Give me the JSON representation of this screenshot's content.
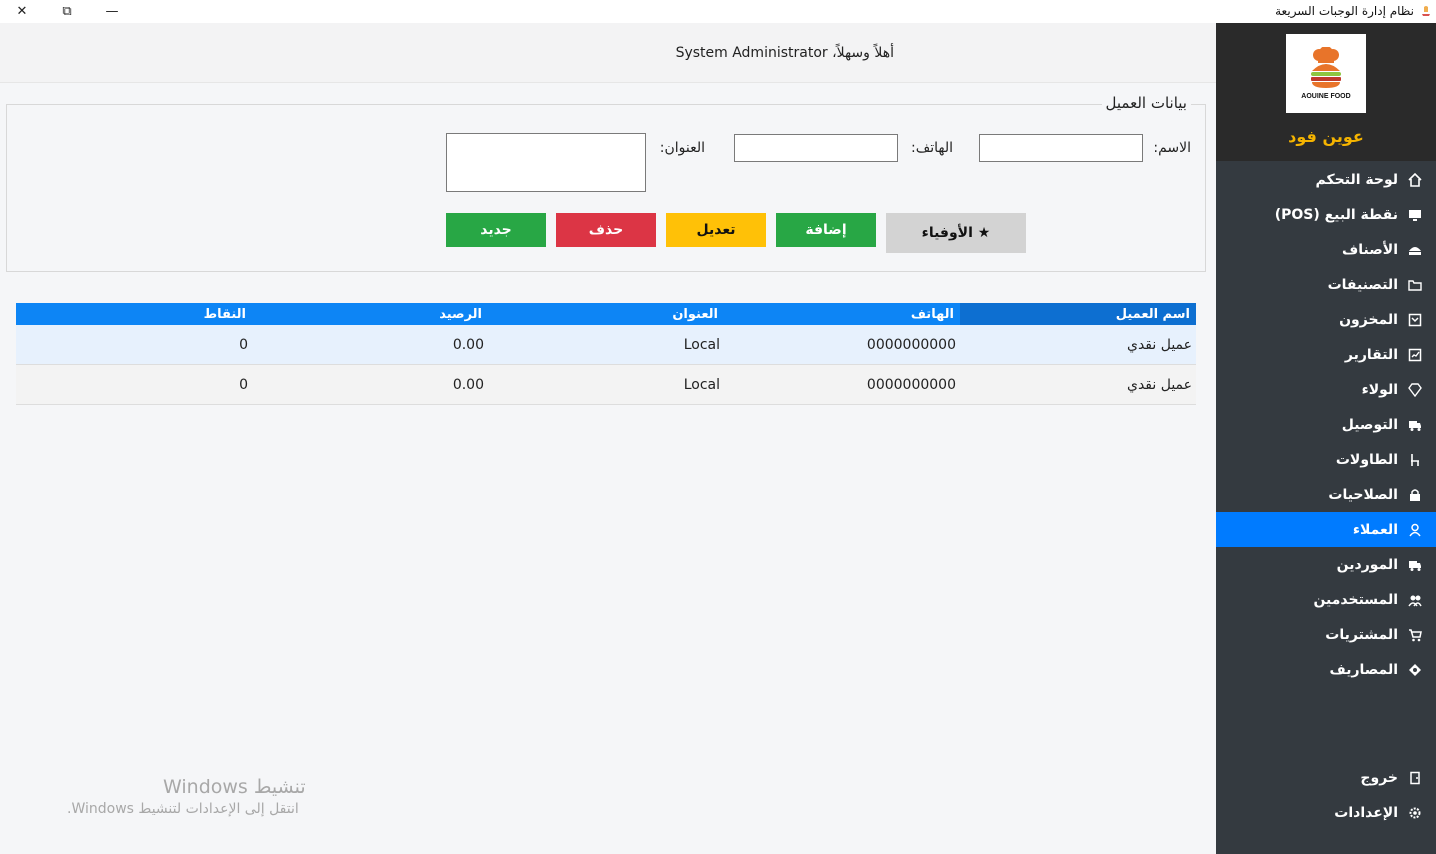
{
  "window": {
    "title": "نظام إدارة الوجبات السريعة",
    "close_glyph": "✕",
    "maximize_glyph": "⧉",
    "minimize_glyph": "—"
  },
  "header": {
    "welcome": "أهلاً وسهلاً، System Administrator"
  },
  "brand": {
    "logo_text": "AOUINE FOOD",
    "name": "عوين فود",
    "name_color": "#f5b400"
  },
  "sidebar": {
    "items": [
      {
        "label": "لوحة التحكم",
        "icon": "home-icon"
      },
      {
        "label": "نقطة البيع (POS)",
        "icon": "monitor-icon"
      },
      {
        "label": "الأصناف",
        "icon": "food-icon"
      },
      {
        "label": "التصنيفات",
        "icon": "folder-icon"
      },
      {
        "label": "المخزون",
        "icon": "box-icon"
      },
      {
        "label": "التقارير",
        "icon": "chart-icon"
      },
      {
        "label": "الولاء",
        "icon": "diamond-icon"
      },
      {
        "label": "التوصيل",
        "icon": "truck-icon"
      },
      {
        "label": "الطاولات",
        "icon": "chair-icon"
      },
      {
        "label": "الصلاحيات",
        "icon": "lock-icon"
      },
      {
        "label": "العملاء",
        "icon": "user-icon",
        "active": true
      },
      {
        "label": "الموردين",
        "icon": "truck-icon"
      },
      {
        "label": "المستخدمين",
        "icon": "users-icon"
      },
      {
        "label": "المشتريات",
        "icon": "cart-icon"
      },
      {
        "label": "المصاريف",
        "icon": "money-icon"
      }
    ],
    "bottom": [
      {
        "label": "خروج",
        "icon": "door-icon"
      },
      {
        "label": "الإعدادات",
        "icon": "gear-icon"
      }
    ],
    "bg_color": "#343a40",
    "active_color": "#007bff"
  },
  "form": {
    "title": "بيانات العميل",
    "name_label": "الاسم:",
    "name_value": "",
    "phone_label": "الهاتف:",
    "phone_value": "",
    "address_label": "العنوان:",
    "address_value": "",
    "buttons": {
      "loyal": "★ الأوفياء",
      "add": "إضافة",
      "edit": "تعديل",
      "delete": "حذف",
      "new": "جديد"
    }
  },
  "table": {
    "headers": [
      "اسم العميل",
      "الهاتف",
      "العنوان",
      "الرصيد",
      "النقاط"
    ],
    "rows": [
      [
        "عميل نقدي",
        "0000000000",
        "Local",
        "0.00",
        "0"
      ],
      [
        "عميل نقدي",
        "0000000000",
        "Local",
        "0.00",
        "0"
      ]
    ],
    "header_color": "#0d85f5"
  },
  "watermark": {
    "line1": "تنشيط Windows",
    "line2": "انتقل إلى الإعدادات لتنشيط Windows."
  }
}
